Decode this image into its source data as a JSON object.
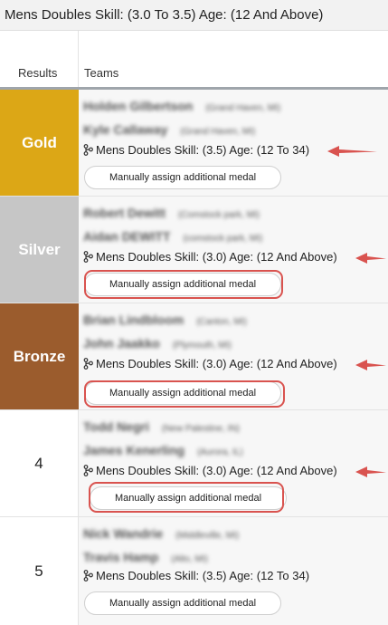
{
  "page": {
    "title": "Mens Doubles Skill: (3.0 To 3.5) Age: (12 And Above)"
  },
  "table": {
    "col_results": "Results",
    "col_teams": "Teams"
  },
  "colors": {
    "gold": "#dca716",
    "silver": "#c6c6c6",
    "bronze": "#9b5c2d",
    "annotation": "#d9534f"
  },
  "icons": {
    "division": "branch-icon",
    "pointer": "red-arrow-annotation"
  },
  "rows": [
    {
      "result": "Gold",
      "players": [
        {
          "name": "Holden Gilbertson",
          "location": "(Grand Haven, MI)"
        },
        {
          "name": "Kyle Callaway",
          "location": "(Grand Haven, MI)"
        }
      ],
      "division": "Mens Doubles Skill: (3.5) Age: (12 To 34)",
      "button": "Manually assign additional medal"
    },
    {
      "result": "Silver",
      "players": [
        {
          "name": "Robert Dewitt",
          "location": "(Comstock park, MI)"
        },
        {
          "name": "Aidan DEWITT",
          "location": "(comstock park, MI)"
        }
      ],
      "division": "Mens Doubles Skill: (3.0) Age: (12 And Above)",
      "button": "Manually assign additional medal"
    },
    {
      "result": "Bronze",
      "players": [
        {
          "name": "Brian Lindbloom",
          "location": "(Canton, MI)"
        },
        {
          "name": "John Jaakko",
          "location": "(Plymouth, MI)"
        }
      ],
      "division": "Mens Doubles Skill: (3.0) Age: (12 And Above)",
      "button": "Manually assign additional medal"
    },
    {
      "result": "4",
      "players": [
        {
          "name": "Todd Negri",
          "location": "(New Palestine, IN)"
        },
        {
          "name": "James Kenerling",
          "location": "(Aurora, IL)"
        }
      ],
      "division": "Mens Doubles Skill: (3.0) Age: (12 And Above)",
      "button": "Manually assign additional medal"
    },
    {
      "result": "5",
      "players": [
        {
          "name": "Nick Wandrie",
          "location": "(Middleville, MI)"
        },
        {
          "name": "Travis Hamp",
          "location": "(Alto, MI)"
        }
      ],
      "division": "Mens Doubles Skill: (3.5) Age: (12 To 34)",
      "button": "Manually assign additional medal"
    }
  ]
}
